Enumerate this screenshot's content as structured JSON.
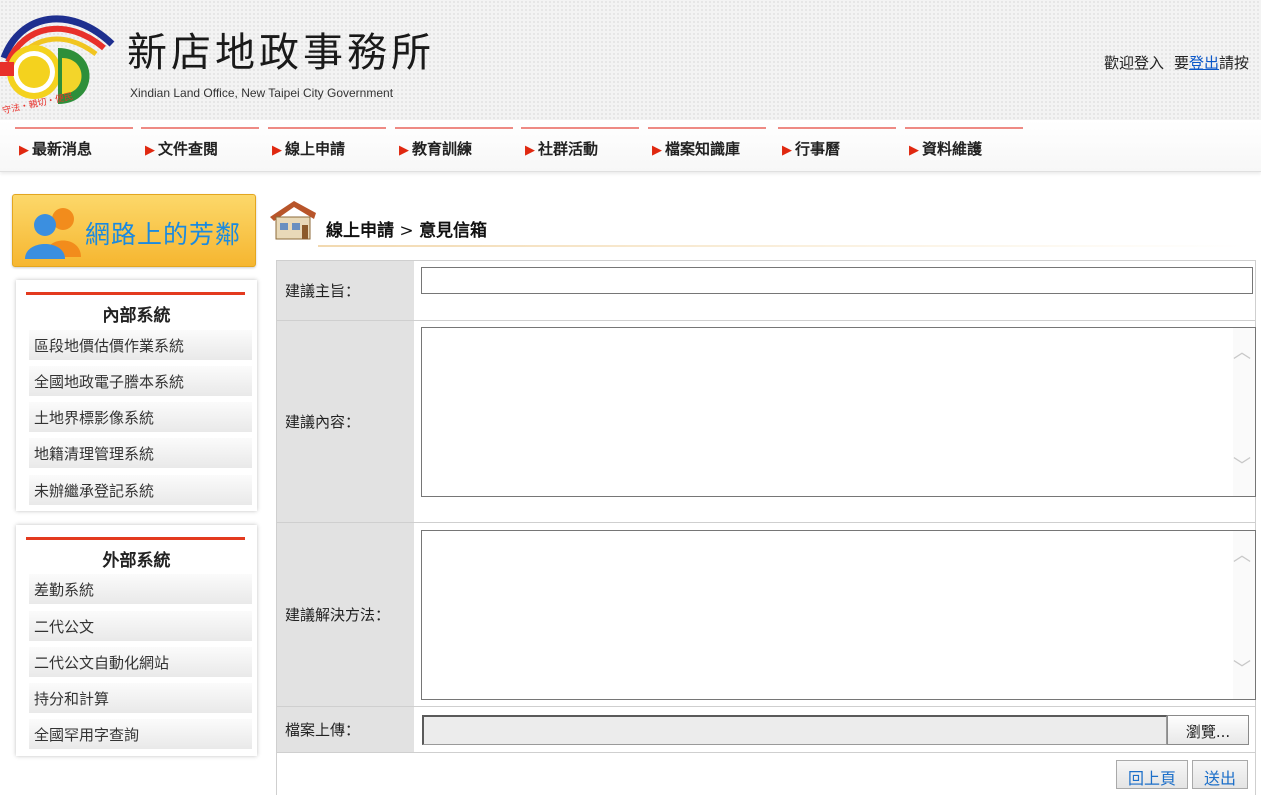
{
  "header": {
    "title": "新店地政事務所",
    "subtitle": "Xindian Land Office, New Taipei City Government",
    "logo_text": "守法・親切・便民",
    "user_greeting": "歡迎登入",
    "logout_prefix": "要",
    "logout_label": "登出",
    "logout_suffix": "請按"
  },
  "nav": {
    "items": [
      {
        "label": "最新消息"
      },
      {
        "label": "文件查閱"
      },
      {
        "label": "線上申請"
      },
      {
        "label": "教育訓練"
      },
      {
        "label": "社群活動"
      },
      {
        "label": "檔案知識庫"
      },
      {
        "label": "行事曆"
      },
      {
        "label": "資料維護"
      }
    ],
    "bullet": "▶",
    "accent_color": "#e02810"
  },
  "sidebar": {
    "banner_text": "網路上的芳鄰",
    "internal": {
      "title": "內部系統",
      "items": [
        {
          "label": "區段地價估價作業系統"
        },
        {
          "label": "全國地政電子謄本系統"
        },
        {
          "label": "土地界標影像系統"
        },
        {
          "label": "地籍清理管理系統"
        },
        {
          "label": "未辦繼承登記系統"
        }
      ]
    },
    "external": {
      "title": "外部系統",
      "items": [
        {
          "label": "差勤系統"
        },
        {
          "label": "二代公文"
        },
        {
          "label": "二代公文自動化網站"
        },
        {
          "label": "持分和計算"
        },
        {
          "label": "全國罕用字查詢"
        }
      ]
    }
  },
  "breadcrumb": {
    "section": "線上申請",
    "separator": ">",
    "page": "意見信箱"
  },
  "form": {
    "subject_label": "建議主旨：",
    "subject_value": "",
    "content_label": "建議內容：",
    "content_value": "",
    "solution_label": "建議解決方法：",
    "solution_value": "",
    "upload_label": "檔案上傳：",
    "browse_label": "瀏覽...",
    "back_label": "回上頁",
    "submit_label": "送出"
  }
}
